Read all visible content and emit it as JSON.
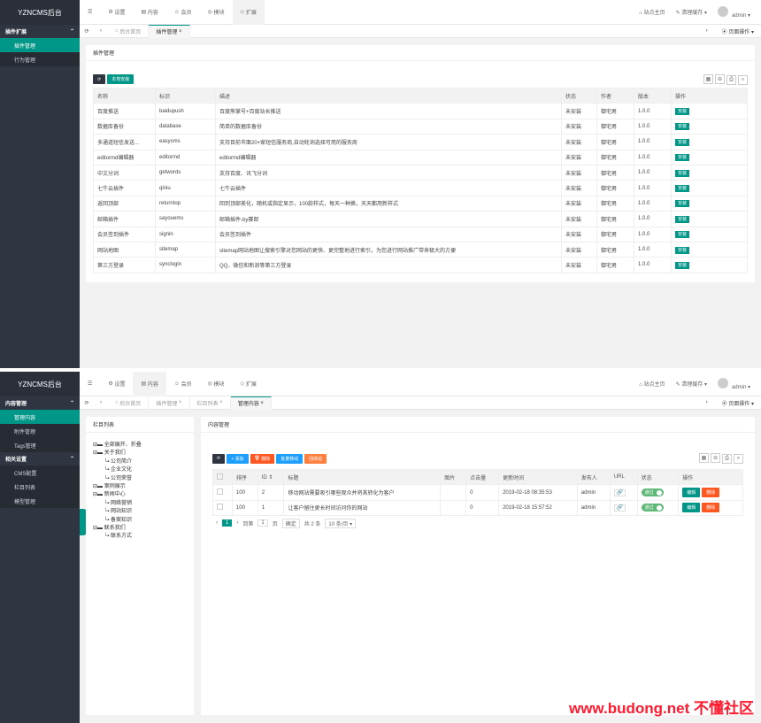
{
  "brand": "YZNCMS后台",
  "topnav": {
    "list_icon": "☰",
    "settings": "设置",
    "content": "内容",
    "member": "会员",
    "module": "模块",
    "extend": "扩展",
    "site_home": "站点主页",
    "clear_cache": "清理缓存",
    "user": "admin"
  },
  "tabs": {
    "home": "后台首页",
    "plugin": "插件管理",
    "column": "栏目列表",
    "content": "管理内容",
    "page_ops": "页面操作"
  },
  "screen1": {
    "menu_group": "插件扩展",
    "menu_items": [
      "插件管理",
      "行为管理"
    ],
    "card_title": "插件管理",
    "local_install": "本地安装",
    "headers": [
      "名称",
      "标识",
      "描述",
      "状态",
      "作者",
      "版本",
      "操作"
    ],
    "rows": [
      [
        "百度推送",
        "baidupush",
        "百度熊掌号+百度站长推送",
        "未安装",
        "御宅男",
        "1.0.0",
        "安装"
      ],
      [
        "数据库备份",
        "database",
        "简单的数据库备份",
        "未安装",
        "御宅男",
        "1.0.0",
        "安装"
      ],
      [
        "多通道短信发送...",
        "easysms",
        "支持目前市面20+家短信服务商,自动轮询选择可用的服务商",
        "未安装",
        "御宅男",
        "1.0.0",
        "安装"
      ],
      [
        "editormd编辑器",
        "editormd",
        "editormd编辑器",
        "未安装",
        "御宅男",
        "1.0.0",
        "安装"
      ],
      [
        "中文分词",
        "getwords",
        "支持百度、讯飞分词",
        "未安装",
        "御宅男",
        "1.0.0",
        "安装"
      ],
      [
        "七牛云插件",
        "qiniu",
        "七牛云插件",
        "未安装",
        "御宅男",
        "1.0.0",
        "安装"
      ],
      [
        "返回顶部",
        "returntop",
        "回到顶部美化，随机或指定显示，100款样式，每天一种换，天天都用新样式",
        "未安装",
        "御宅男",
        "1.0.0",
        "安装"
      ],
      [
        "邮箱插件",
        "sayouems",
        "邮箱插件-by赛郎",
        "未安装",
        "御宅男",
        "1.0.0",
        "安装"
      ],
      [
        "会员签到插件",
        "signin",
        "会员签到插件",
        "未安装",
        "御宅男",
        "1.0.0",
        "安装"
      ],
      [
        "网站地图",
        "sitemap",
        "sitemap网站地图让搜索引擎对您网站的更快、更完整地进行索引，为您进行网站推广带来极大的方便",
        "未安装",
        "御宅男",
        "1.0.0",
        "安装"
      ],
      [
        "第三方登录",
        "synclogin",
        "QQ，微信和新浪等第三方登录",
        "未安装",
        "御宅男",
        "1.0.0",
        "安装"
      ]
    ]
  },
  "screen2": {
    "menu_group1": "内容管理",
    "menu_items1": [
      "管理内容",
      "附件管理",
      "Tags管理"
    ],
    "menu_group2": "相关设置",
    "menu_items2": [
      "CMS配置",
      "栏目列表",
      "模型管理"
    ],
    "tree_title": "栏目列表",
    "tree": [
      {
        "t": "全部展开、折叠",
        "lvl": 0
      },
      {
        "t": "关于我们",
        "lvl": 0
      },
      {
        "t": "公司简介",
        "lvl": 1
      },
      {
        "t": "企业文化",
        "lvl": 1
      },
      {
        "t": "公司荣誉",
        "lvl": 1
      },
      {
        "t": "案例展示",
        "lvl": 0
      },
      {
        "t": "新闻中心",
        "lvl": 0
      },
      {
        "t": "网络营销",
        "lvl": 1
      },
      {
        "t": "网站知识",
        "lvl": 1
      },
      {
        "t": "备案知识",
        "lvl": 1
      },
      {
        "t": "联系我们",
        "lvl": 0
      },
      {
        "t": "联系方式",
        "lvl": 1
      }
    ],
    "content_title": "内容管理",
    "btn_add": "+ 添加",
    "btn_delete": "删除",
    "btn_move": "批量移动",
    "btn_recycle": "回收站",
    "headers": [
      "",
      "排序",
      "ID ⇕",
      "标题",
      "图片",
      "点击量",
      "更新时间",
      "发布人",
      "URL",
      "状态",
      "操作"
    ],
    "rows": [
      [
        "",
        "100",
        "2",
        "移动网站需要吸引哪些观众并将其转化为客户",
        "",
        "0",
        "2019-02-18 08:35:53",
        "admin",
        "🔗",
        "通过",
        "编辑",
        "删除"
      ],
      [
        "",
        "100",
        "1",
        "让客户留住更长时间访问你的网站",
        "",
        "0",
        "2019-02-18 15:57:52",
        "admin",
        "🔗",
        "通过",
        "编辑",
        "删除"
      ]
    ],
    "pager": {
      "prev": "‹",
      "cur": "1",
      "next": "›",
      "goto": "到第",
      "page_val": "1",
      "page": "页",
      "confirm": "确定",
      "total": "共 2 条",
      "size": "10 条/页 ▾"
    }
  },
  "watermark": "www.budong.net 不懂社区"
}
